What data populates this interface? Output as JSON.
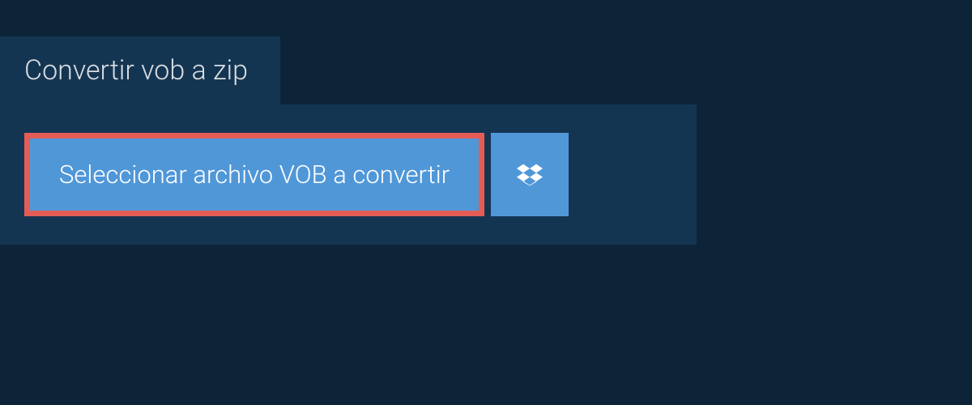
{
  "tab": {
    "label": "Convertir vob a zip"
  },
  "buttons": {
    "select_file": "Seleccionar archivo VOB a convertir"
  }
}
